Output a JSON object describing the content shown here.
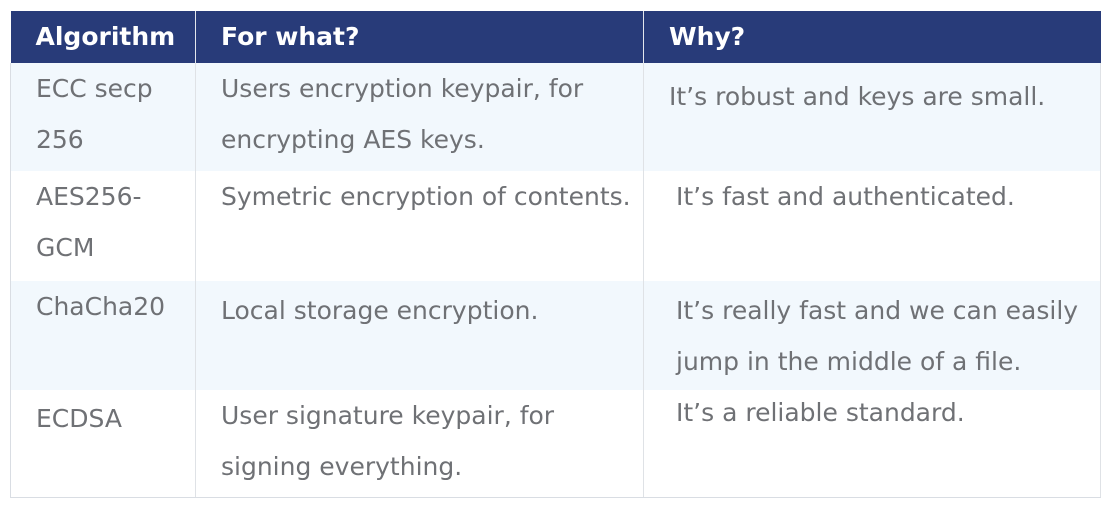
{
  "table": {
    "headers": [
      "Algorithm",
      "For what?",
      "Why?"
    ],
    "rows": [
      [
        "ECC secp 256",
        "Users encryption keypair, for encrypting AES keys.",
        "It’s robust and keys are small."
      ],
      [
        "AES256-GCM",
        "Symetric encryption of contents.",
        "It’s fast and authenticated."
      ],
      [
        "ChaCha20",
        "Local storage encryption.",
        "It’s really fast and we can easily jump in the middle of a file."
      ],
      [
        "ECDSA",
        "User signature keypair, for signing everything.",
        "It’s a reliable standard."
      ]
    ]
  },
  "colors": {
    "header_bg": "#283b79",
    "header_text": "#ffffff",
    "row_alt_bg": "#f2f8fd",
    "text": "#6f7175"
  }
}
